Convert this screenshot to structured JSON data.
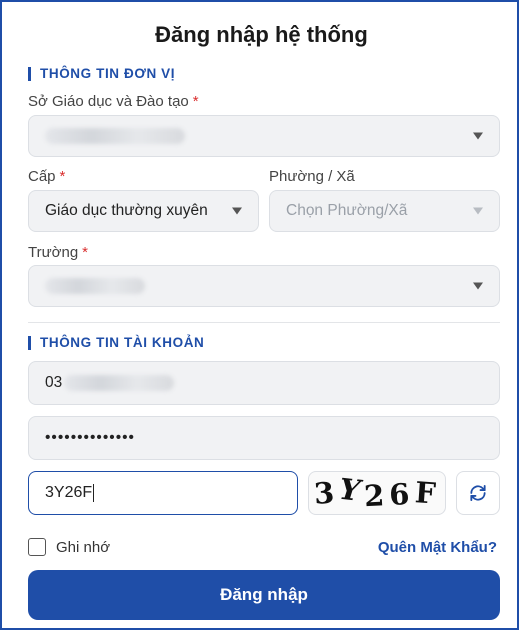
{
  "title": "Đăng nhập hệ thống",
  "unit_section": {
    "heading": "THÔNG TIN ĐƠN VỊ",
    "department": {
      "label": "Sở Giáo dục và Đào tạo",
      "required": "*",
      "value": ""
    },
    "level": {
      "label": "Cấp",
      "required": "*",
      "value": "Giáo dục thường xuyên"
    },
    "ward": {
      "label": "Phường / Xã",
      "placeholder": "Chọn Phường/Xã"
    },
    "school": {
      "label": "Trường",
      "required": "*",
      "value": ""
    }
  },
  "account_section": {
    "heading": "THÔNG TIN TÀI KHOẢN",
    "username": {
      "value": "03"
    },
    "password": {
      "value": "••••••••••••••"
    },
    "captcha_input": {
      "value": "3Y26F"
    },
    "captcha_image": {
      "chars": [
        "3",
        "Y",
        "26",
        "F"
      ]
    }
  },
  "remember": {
    "label": "Ghi nhớ",
    "checked": false
  },
  "forgot_label": "Quên Mật Khẩu?",
  "submit_label": "Đăng nhập",
  "colors": {
    "accent": "#1f4ea8",
    "required": "#d92d2d"
  }
}
